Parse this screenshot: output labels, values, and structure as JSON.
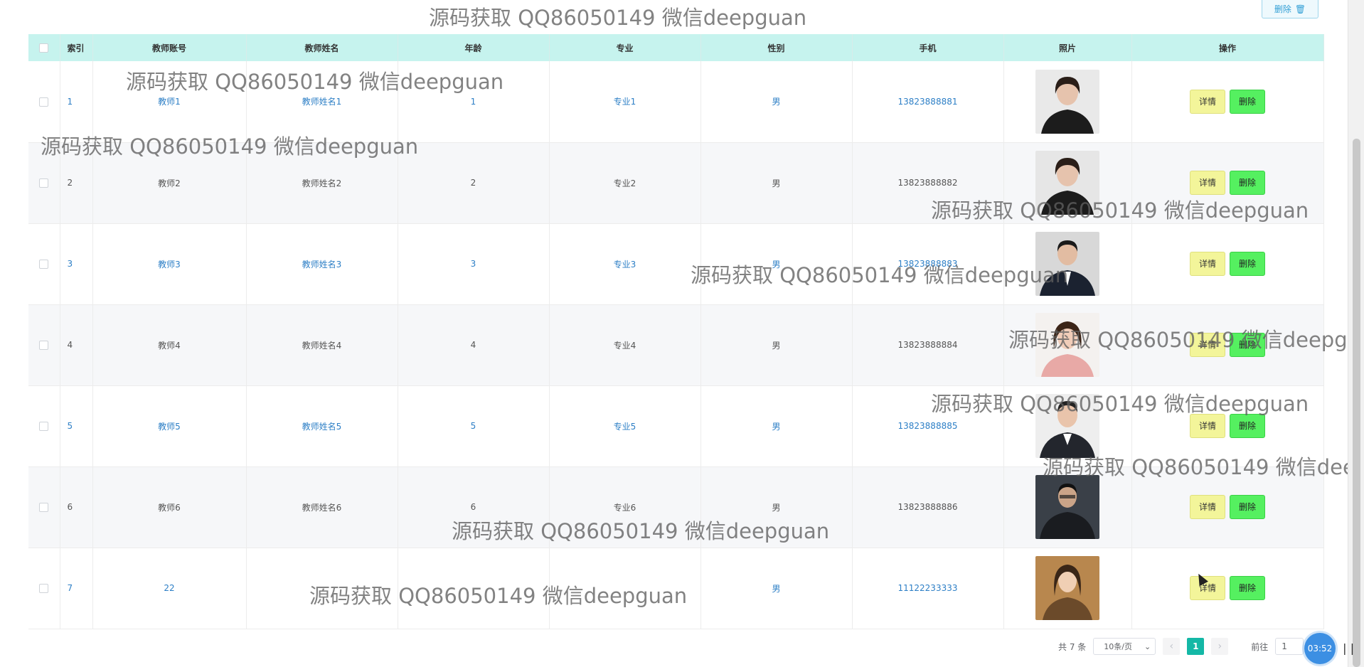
{
  "toolbar": {
    "delete_label": "删除"
  },
  "table": {
    "headers": [
      "索引",
      "教师账号",
      "教师姓名",
      "年龄",
      "专业",
      "性别",
      "手机",
      "照片",
      "操作"
    ],
    "rows": [
      {
        "index": "1",
        "account": "教师1",
        "name": "教师姓名1",
        "age": "1",
        "major": "专业1",
        "gender": "男",
        "phone": "13823888881"
      },
      {
        "index": "2",
        "account": "教师2",
        "name": "教师姓名2",
        "age": "2",
        "major": "专业2",
        "gender": "男",
        "phone": "13823888882"
      },
      {
        "index": "3",
        "account": "教师3",
        "name": "教师姓名3",
        "age": "3",
        "major": "专业3",
        "gender": "男",
        "phone": "13823888883"
      },
      {
        "index": "4",
        "account": "教师4",
        "name": "教师姓名4",
        "age": "4",
        "major": "专业4",
        "gender": "男",
        "phone": "13823888884"
      },
      {
        "index": "5",
        "account": "教师5",
        "name": "教师姓名5",
        "age": "5",
        "major": "专业5",
        "gender": "男",
        "phone": "13823888885"
      },
      {
        "index": "6",
        "account": "教师6",
        "name": "教师姓名6",
        "age": "6",
        "major": "专业6",
        "gender": "男",
        "phone": "13823888886"
      },
      {
        "index": "7",
        "account": "22",
        "name": "",
        "age": "",
        "major": "",
        "gender": "男",
        "phone": "11122233333"
      }
    ],
    "detail_label": "详情",
    "delete_label": "删除"
  },
  "pagination": {
    "total": "共 7 条",
    "page_size": "10条/页",
    "current_page": "1",
    "goto_label": "前往",
    "goto_value": "1"
  },
  "recorder": {
    "time": "03:52",
    "pause": "||"
  },
  "watermark": "源码获取 QQ86050149 微信deepguan"
}
